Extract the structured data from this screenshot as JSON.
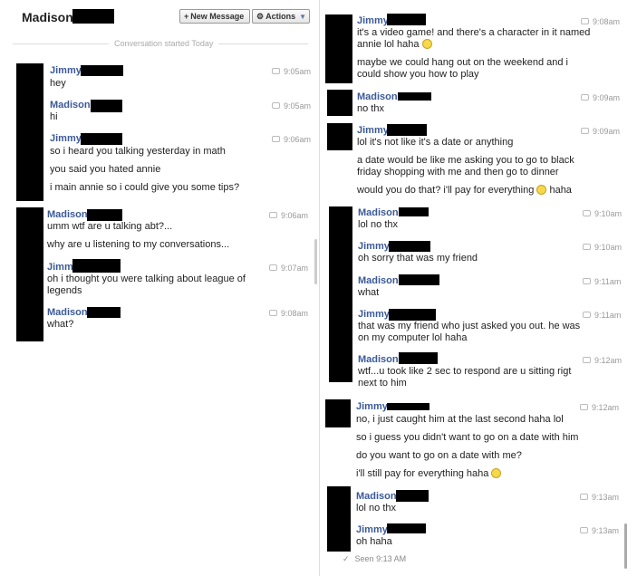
{
  "header": {
    "title": "Madison",
    "new_message_label": "New Message",
    "actions_label": "Actions"
  },
  "conversation_started": "Conversation started Today",
  "seen": "Seen 9:13 AM",
  "left": [
    {
      "name": "Jimmy",
      "time": "9:05am",
      "lines": [
        "hey"
      ]
    },
    {
      "name": "Madison",
      "time": "9:05am",
      "lines": [
        "hi"
      ]
    },
    {
      "name": "Jimmy",
      "time": "9:06am",
      "lines": [
        "so i heard you talking yesterday in math",
        "you said you hated annie",
        "i main annie so i could give you some tips?"
      ]
    },
    {
      "name": "Madison",
      "time": "9:06am",
      "lines": [
        "umm wtf are u talking abt?...",
        "why are u listening to my conversations..."
      ]
    },
    {
      "name": "Jimmy",
      "time": "9:07am",
      "lines": [
        "oh i thought you were talking about league of",
        "legends"
      ]
    },
    {
      "name": "Madison",
      "time": "9:08am",
      "lines": [
        "what?"
      ]
    }
  ],
  "right": [
    {
      "name": "Jimmy",
      "time": "9:08am",
      "lines": [
        "it's a video game! and there's a character in it named",
        "annie lol haha",
        "maybe we could hang out on the weekend and i",
        "could show you how to play"
      ]
    },
    {
      "name": "Madison",
      "time": "9:09am",
      "lines": [
        "no thx"
      ]
    },
    {
      "name": "Jimmy",
      "time": "9:09am",
      "lines": [
        "lol it's not like it's a date or anything",
        "a date would be like me asking you to go to black",
        "friday shopping with me and then go to dinner",
        "would you do that? i'll pay for everything",
        "haha"
      ]
    },
    {
      "name": "Madison",
      "time": "9:10am",
      "lines": [
        "lol no thx"
      ]
    },
    {
      "name": "Jimmy",
      "time": "9:10am",
      "lines": [
        "oh sorry that was my friend"
      ]
    },
    {
      "name": "Madison",
      "time": "9:11am",
      "lines": [
        "what"
      ]
    },
    {
      "name": "Jimmy",
      "time": "9:11am",
      "lines": [
        "that was my friend who just asked you out. he was",
        "on my computer lol haha"
      ]
    },
    {
      "name": "Madison",
      "time": "9:12am",
      "lines": [
        "wtf...u took like 2 sec to respond are u sitting rigt",
        "next to him"
      ]
    },
    {
      "name": "Jimmy",
      "time": "9:12am",
      "lines": [
        "no, i just caught him at the last second haha lol",
        "so i guess you didn't want to go on a date with him",
        "do you want to go on a date with me?",
        "i'll still pay for everything haha"
      ]
    },
    {
      "name": "Madison",
      "time": "9:13am",
      "lines": [
        "lol no thx"
      ]
    },
    {
      "name": "Jimmy",
      "time": "9:13am",
      "lines": [
        "oh haha"
      ]
    }
  ]
}
